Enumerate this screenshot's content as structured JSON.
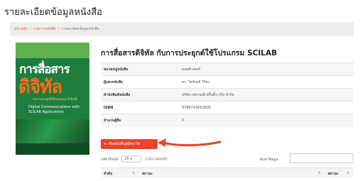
{
  "page": {
    "title": "รายละเอียดข้อมูลหนังสือ"
  },
  "breadcrumb": {
    "items": [
      "หน้าหลัก",
      "รายการหนังสือ"
    ],
    "current": "รายละเอียดข้อมูลหนังสือ"
  },
  "cover": {
    "title_line1": "การสื่อสาร",
    "title_line2": "ดิจิทัล",
    "subtitle": "กับการประยุกต์ใช้โปรแกรม SCILAB",
    "english_title": "Digital Communications with SCILAB Applications"
  },
  "book": {
    "title": "การสื่อสารดิจิทัล กับการประยุกต์ใช้โปรแกรม SCILAB",
    "fields": [
      {
        "label": "หมวดหมู่หนังสือ",
        "value": "คอมพิวเตอร์"
      },
      {
        "label": "ผู้แต่งหนังสือ",
        "value": "ดร. วิศรัณฑ์ วิริยะ"
      },
      {
        "label": "สำนักพิมพ์หนังสือ",
        "value": "บริษัท เพชรมณี พริ้นติ้ง กรุ๊ป จำกัด"
      },
      {
        "label": "ISBN",
        "value": "9789743651830"
      },
      {
        "label": "จำนวนผู้ยืม",
        "value": "0"
      }
    ]
  },
  "actions": {
    "add_button_label": "เพิ่มหนังสือสู่บุ๊คมาร์ค",
    "add_icon": "+"
  },
  "table_controls": {
    "show_label": "แสดงข้อมูล",
    "page_length": "25",
    "entries_label": "รายการต่อหน้า",
    "search_label": "ค้นหาข้อมูล :",
    "search_value": ""
  },
  "list": {
    "columns": [
      "ลำดับ",
      "สถานะ"
    ],
    "sort_icon": "⇅",
    "right_columns": [
      "สถานะ"
    ]
  },
  "colors": {
    "accent": "#e8452c",
    "breadcrumb_link": "#d9534f",
    "cover_green": "#1f7d3f"
  }
}
